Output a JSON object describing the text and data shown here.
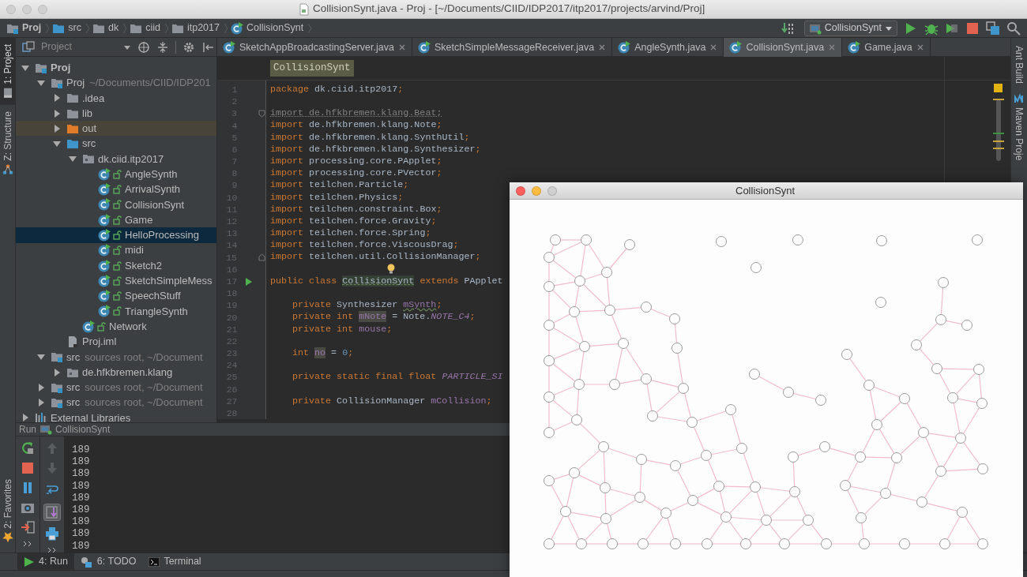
{
  "window": {
    "title": "CollisionSynt.java - Proj - [~/Documents/CIID/IDP2017/itp2017/projects/arvind/Proj]"
  },
  "breadcrumbs": [
    {
      "label": "Proj",
      "kind": "module",
      "bold": true
    },
    {
      "label": "src",
      "kind": "source-folder"
    },
    {
      "label": "dk",
      "kind": "folder"
    },
    {
      "label": "ciid",
      "kind": "folder"
    },
    {
      "label": "itp2017",
      "kind": "folder"
    },
    {
      "label": "CollisionSynt",
      "kind": "class"
    }
  ],
  "run_config": {
    "label": "CollisionSynt"
  },
  "tool_windows_left_top": [
    {
      "label": "1: Project",
      "kind": "project",
      "selected": true
    },
    {
      "label": "Z: Structure",
      "kind": "structure",
      "selected": false
    }
  ],
  "tool_windows_left_bottom": [
    {
      "label": "2: Favorites",
      "kind": "favorites",
      "selected": false
    }
  ],
  "tool_windows_right": [
    {
      "label": "Ant Build",
      "kind": "ant"
    },
    {
      "label": "Maven Proje",
      "kind": "maven"
    }
  ],
  "project_panel": {
    "title": "Project",
    "tree": [
      {
        "label": "Proj",
        "kind": "module",
        "bold": true,
        "expanded": true,
        "selected": false,
        "children": [
          {
            "label": "Proj",
            "kind": "module",
            "hint": "~/Documents/CIID/IDP201",
            "expanded": true,
            "selected": false,
            "children": [
              {
                "label": ".idea",
                "kind": "folder",
                "expanded": false,
                "selected": false
              },
              {
                "label": "lib",
                "kind": "folder",
                "expanded": false,
                "selected": false
              },
              {
                "label": "out",
                "kind": "excluded-folder",
                "expanded": false,
                "selected": false
              },
              {
                "label": "src",
                "kind": "source-folder",
                "expanded": true,
                "selected": false,
                "children": [
                  {
                    "label": "dk.ciid.itp2017",
                    "kind": "package",
                    "expanded": true,
                    "selected": false,
                    "children": [
                      {
                        "label": "AngleSynth",
                        "kind": "class",
                        "selected": false
                      },
                      {
                        "label": "ArrivalSynth",
                        "kind": "class",
                        "selected": false
                      },
                      {
                        "label": "CollisionSynt",
                        "kind": "class",
                        "selected": false
                      },
                      {
                        "label": "Game",
                        "kind": "class",
                        "selected": false
                      },
                      {
                        "label": "HelloProcessing",
                        "kind": "class",
                        "selected": true
                      },
                      {
                        "label": "midi",
                        "kind": "class",
                        "selected": false
                      },
                      {
                        "label": "Sketch2",
                        "kind": "class",
                        "selected": false
                      },
                      {
                        "label": "SketchSimpleMess",
                        "kind": "class",
                        "selected": false
                      },
                      {
                        "label": "SpeechStuff",
                        "kind": "class",
                        "selected": false
                      },
                      {
                        "label": "TriangleSynth",
                        "kind": "class",
                        "selected": false
                      }
                    ]
                  },
                  {
                    "label": "Network",
                    "kind": "class",
                    "selected": false
                  }
                ]
              },
              {
                "label": "Proj.iml",
                "kind": "file",
                "selected": false
              }
            ]
          },
          {
            "label": "src",
            "kind": "module",
            "hint": "sources root,  ~/Document",
            "expanded": true,
            "selected": false,
            "children": [
              {
                "label": "de.hfkbremen.klang",
                "kind": "package",
                "expanded": false,
                "selected": false
              }
            ]
          },
          {
            "label": "src",
            "kind": "module",
            "hint": "sources root,  ~/Document",
            "expanded": false,
            "selected": false
          },
          {
            "label": "src",
            "kind": "module",
            "hint": "sources root,  ~/Document",
            "expanded": false,
            "selected": false
          }
        ]
      },
      {
        "label": "External Libraries",
        "kind": "library",
        "expanded": false,
        "selected": false
      }
    ]
  },
  "editor": {
    "tabs": [
      {
        "label": "SketchAppBroadcastingServer.java",
        "selected": false
      },
      {
        "label": "SketchSimpleMessageReceiver.java",
        "selected": false
      },
      {
        "label": "AngleSynth.java",
        "selected": false
      },
      {
        "label": "CollisionSynt.java",
        "selected": true
      },
      {
        "label": "Game.java",
        "selected": false
      }
    ],
    "header": "CollisionSynt",
    "lines": [
      {
        "number": "1",
        "indented": false,
        "tokens": [
          {
            "text": "package ",
            "kind": "keyword"
          },
          {
            "text": "dk.ciid.itp2017",
            "kind": "plain"
          },
          {
            "text": ";",
            "kind": "keyword"
          }
        ]
      },
      {
        "number": "2"
      },
      {
        "number": "3",
        "indented": false,
        "fold_start": true,
        "tokens": [
          {
            "text": "import de.hfkbremen.klang.Beat;",
            "kind": "unused"
          }
        ]
      },
      {
        "number": "4",
        "indented": false,
        "tokens": [
          {
            "text": "import ",
            "kind": "keyword"
          },
          {
            "text": "de.hfkbremen.klang.Note",
            "kind": "plain"
          },
          {
            "text": ";",
            "kind": "keyword"
          }
        ]
      },
      {
        "number": "5",
        "indented": false,
        "tokens": [
          {
            "text": "import ",
            "kind": "keyword"
          },
          {
            "text": "de.hfkbremen.klang.SynthUtil",
            "kind": "plain"
          },
          {
            "text": ";",
            "kind": "keyword"
          }
        ]
      },
      {
        "number": "6",
        "indented": false,
        "tokens": [
          {
            "text": "import ",
            "kind": "keyword"
          },
          {
            "text": "de.hfkbremen.klang.Synthesizer",
            "kind": "plain"
          },
          {
            "text": ";",
            "kind": "keyword"
          }
        ]
      },
      {
        "number": "7",
        "indented": false,
        "tokens": [
          {
            "text": "import ",
            "kind": "keyword"
          },
          {
            "text": "processing.core.PApplet",
            "kind": "plain"
          },
          {
            "text": ";",
            "kind": "keyword"
          }
        ]
      },
      {
        "number": "8",
        "indented": false,
        "tokens": [
          {
            "text": "import ",
            "kind": "keyword"
          },
          {
            "text": "processing.core.PVector",
            "kind": "plain"
          },
          {
            "text": ";",
            "kind": "keyword"
          }
        ]
      },
      {
        "number": "9",
        "indented": false,
        "tokens": [
          {
            "text": "import ",
            "kind": "keyword"
          },
          {
            "text": "teilchen.Particle",
            "kind": "plain"
          },
          {
            "text": ";",
            "kind": "keyword"
          }
        ]
      },
      {
        "number": "10",
        "indented": false,
        "tokens": [
          {
            "text": "import ",
            "kind": "keyword"
          },
          {
            "text": "teilchen.Physics",
            "kind": "plain"
          },
          {
            "text": ";",
            "kind": "keyword"
          }
        ]
      },
      {
        "number": "11",
        "indented": false,
        "tokens": [
          {
            "text": "import ",
            "kind": "keyword"
          },
          {
            "text": "teilchen.constraint.Box",
            "kind": "plain"
          },
          {
            "text": ";",
            "kind": "keyword"
          }
        ]
      },
      {
        "number": "12",
        "indented": false,
        "tokens": [
          {
            "text": "import ",
            "kind": "keyword"
          },
          {
            "text": "teilchen.force.Gravity",
            "kind": "plain"
          },
          {
            "text": ";",
            "kind": "keyword"
          }
        ]
      },
      {
        "number": "13",
        "indented": false,
        "tokens": [
          {
            "text": "import ",
            "kind": "keyword"
          },
          {
            "text": "teilchen.force.Spring",
            "kind": "plain"
          },
          {
            "text": ";",
            "kind": "keyword"
          }
        ]
      },
      {
        "number": "14",
        "indented": false,
        "tokens": [
          {
            "text": "import ",
            "kind": "keyword"
          },
          {
            "text": "teilchen.force.ViscousDrag",
            "kind": "plain"
          },
          {
            "text": ";",
            "kind": "keyword"
          }
        ]
      },
      {
        "number": "15",
        "indented": false,
        "fold_end": true,
        "tokens": [
          {
            "text": "import ",
            "kind": "keyword"
          },
          {
            "text": "teilchen.util.CollisionManager",
            "kind": "plain"
          },
          {
            "text": ";",
            "kind": "keyword"
          }
        ]
      },
      {
        "number": "16",
        "bulb": true
      },
      {
        "number": "17",
        "indented": false,
        "runnable": true,
        "tokens": [
          {
            "text": "public class ",
            "kind": "keyword"
          },
          {
            "text": "CollisionSynt",
            "kind": "declaration"
          },
          {
            "text": " extends ",
            "kind": "keyword"
          },
          {
            "text": "PApplet",
            "kind": "plain"
          }
        ]
      },
      {
        "number": "18"
      },
      {
        "number": "19",
        "indented": true,
        "tokens": [
          {
            "text": "private ",
            "kind": "keyword"
          },
          {
            "text": "Synthesizer ",
            "kind": "plain"
          },
          {
            "text": "mSynth",
            "kind": "field-warning"
          },
          {
            "text": ";",
            "kind": "keyword"
          }
        ]
      },
      {
        "number": "20",
        "indented": true,
        "tokens": [
          {
            "text": "private int ",
            "kind": "keyword"
          },
          {
            "text": "mNote",
            "kind": "usage"
          },
          {
            "text": " = Note.",
            "kind": "plain"
          },
          {
            "text": "NOTE_C4",
            "kind": "constant"
          },
          {
            "text": ";",
            "kind": "keyword"
          }
        ]
      },
      {
        "number": "21",
        "indented": true,
        "tokens": [
          {
            "text": "private int ",
            "kind": "keyword"
          },
          {
            "text": "mouse",
            "kind": "field"
          },
          {
            "text": ";",
            "kind": "keyword"
          }
        ]
      },
      {
        "number": "22"
      },
      {
        "number": "23",
        "indented": true,
        "tokens": [
          {
            "text": "int ",
            "kind": "keyword"
          },
          {
            "text": "no",
            "kind": "usage"
          },
          {
            "text": " = ",
            "kind": "plain"
          },
          {
            "text": "0",
            "kind": "number"
          },
          {
            "text": ";",
            "kind": "keyword"
          }
        ]
      },
      {
        "number": "24"
      },
      {
        "number": "25",
        "indented": true,
        "tokens": [
          {
            "text": "private static final float ",
            "kind": "keyword"
          },
          {
            "text": "PARTICLE_SI",
            "kind": "constant"
          }
        ]
      },
      {
        "number": "26"
      },
      {
        "number": "27",
        "indented": true,
        "tokens": [
          {
            "text": "private ",
            "kind": "keyword"
          },
          {
            "text": "CollisionManager ",
            "kind": "plain"
          },
          {
            "text": "mCollision",
            "kind": "field"
          },
          {
            "text": ";",
            "kind": "keyword"
          }
        ]
      },
      {
        "number": "28"
      }
    ]
  },
  "run_panel": {
    "title": "Run",
    "config": "CollisionSynt",
    "toggles": [
      {
        "kind": "soft-wrap",
        "on": false
      },
      {
        "kind": "scroll-to-end",
        "on": true
      }
    ],
    "output": [
      "189",
      "189",
      "189",
      "189",
      "189",
      "189",
      "189",
      "189",
      "189"
    ]
  },
  "bottom_tabs": [
    {
      "label": "4: Run",
      "kind": "run",
      "selected": true
    },
    {
      "label": "6: TODO",
      "kind": "todo",
      "selected": false
    },
    {
      "label": "Terminal",
      "kind": "terminal",
      "selected": false
    }
  ],
  "sketch_window": {
    "title": "CollisionSynt"
  }
}
